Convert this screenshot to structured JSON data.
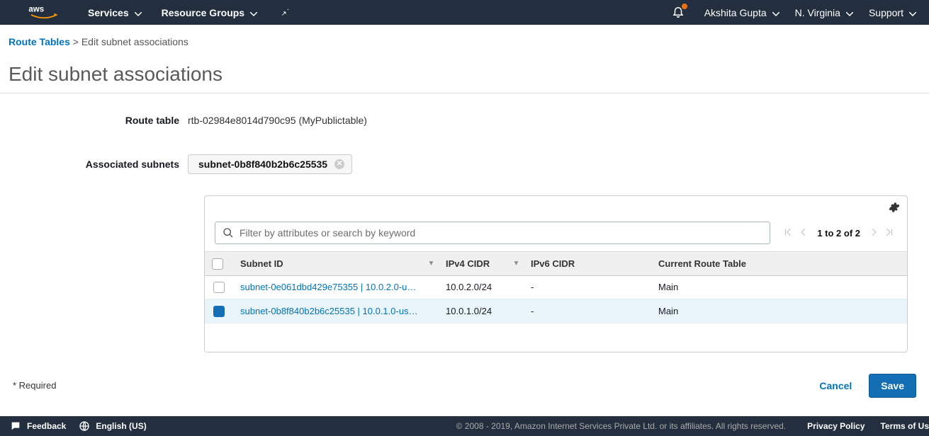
{
  "nav": {
    "services": "Services",
    "resource_groups": "Resource Groups",
    "user": "Akshita Gupta",
    "region": "N. Virginia",
    "support": "Support"
  },
  "breadcrumb": {
    "root": "Route Tables",
    "sep": ">",
    "current": "Edit subnet associations"
  },
  "page_title": "Edit subnet associations",
  "fields": {
    "route_table_label": "Route table",
    "route_table_value": "rtb-02984e8014d790c95 (MyPublictable)",
    "assoc_label": "Associated subnets",
    "assoc_tag": "subnet-0b8f840b2b6c25535"
  },
  "search": {
    "placeholder": "Filter by attributes or search by keyword"
  },
  "pager": {
    "text": "1 to 2 of 2"
  },
  "table": {
    "headers": {
      "subnet": "Subnet ID",
      "v4": "IPv4 CIDR",
      "v6": "IPv6 CIDR",
      "route": "Current Route Table"
    },
    "rows": [
      {
        "checked": false,
        "subnet": "subnet-0e061dbd429e75355 | 10.0.2.0-u…",
        "v4": "10.0.2.0/24",
        "v6": "-",
        "route": "Main"
      },
      {
        "checked": true,
        "subnet": "subnet-0b8f840b2b6c25535 | 10.0.1.0-us…",
        "v4": "10.0.1.0/24",
        "v6": "-",
        "route": "Main"
      }
    ]
  },
  "actions": {
    "required": "* Required",
    "cancel": "Cancel",
    "save": "Save"
  },
  "footer": {
    "feedback": "Feedback",
    "language": "English (US)",
    "copy": "© 2008 - 2019, Amazon Internet Services Private Ltd. or its affiliates. All rights reserved.",
    "privacy": "Privacy Policy",
    "terms": "Terms of Us"
  }
}
